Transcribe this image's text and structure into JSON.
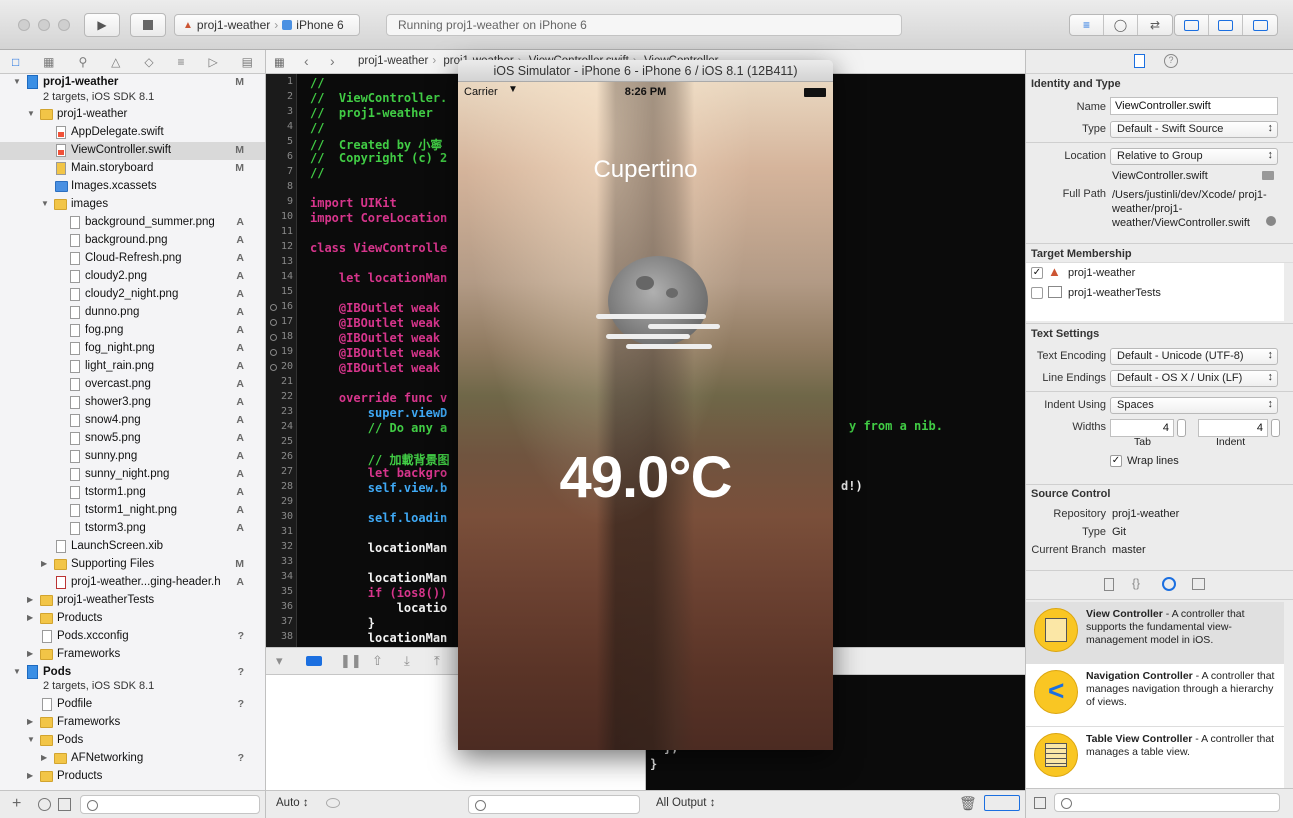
{
  "toolbar": {
    "scheme_project": "proj1-weather",
    "scheme_device": "iPhone 6",
    "status_text": "Running proj1-weather on iPhone 6"
  },
  "navigator": {
    "items": [
      {
        "label": "proj1-weather",
        "sub": "2 targets, iOS SDK 8.1",
        "badge": "M"
      },
      {
        "label": "proj1-weather",
        "badge": ""
      },
      {
        "label": "AppDelegate.swift",
        "badge": ""
      },
      {
        "label": "ViewController.swift",
        "badge": "M"
      },
      {
        "label": "Main.storyboard",
        "badge": "M"
      },
      {
        "label": "Images.xcassets",
        "badge": ""
      },
      {
        "label": "images",
        "badge": ""
      },
      {
        "label": "background_summer.png",
        "badge": "A"
      },
      {
        "label": "background.png",
        "badge": "A"
      },
      {
        "label": "Cloud-Refresh.png",
        "badge": "A"
      },
      {
        "label": "cloudy2.png",
        "badge": "A"
      },
      {
        "label": "cloudy2_night.png",
        "badge": "A"
      },
      {
        "label": "dunno.png",
        "badge": "A"
      },
      {
        "label": "fog.png",
        "badge": "A"
      },
      {
        "label": "fog_night.png",
        "badge": "A"
      },
      {
        "label": "light_rain.png",
        "badge": "A"
      },
      {
        "label": "overcast.png",
        "badge": "A"
      },
      {
        "label": "shower3.png",
        "badge": "A"
      },
      {
        "label": "snow4.png",
        "badge": "A"
      },
      {
        "label": "snow5.png",
        "badge": "A"
      },
      {
        "label": "sunny.png",
        "badge": "A"
      },
      {
        "label": "sunny_night.png",
        "badge": "A"
      },
      {
        "label": "tstorm1.png",
        "badge": "A"
      },
      {
        "label": "tstorm1_night.png",
        "badge": "A"
      },
      {
        "label": "tstorm3.png",
        "badge": "A"
      },
      {
        "label": "LaunchScreen.xib",
        "badge": ""
      },
      {
        "label": "Supporting Files",
        "badge": "M"
      },
      {
        "label": "proj1-weather...ging-header.h",
        "badge": "A"
      },
      {
        "label": "proj1-weatherTests",
        "badge": ""
      },
      {
        "label": "Products",
        "badge": ""
      },
      {
        "label": "Pods.xcconfig",
        "badge": "?"
      },
      {
        "label": "Frameworks",
        "badge": ""
      },
      {
        "label": "Pods",
        "sub": "2 targets, iOS SDK 8.1",
        "badge": "?"
      },
      {
        "label": "Podfile",
        "badge": "?"
      },
      {
        "label": "Frameworks",
        "badge": ""
      },
      {
        "label": "Pods",
        "badge": ""
      },
      {
        "label": "AFNetworking",
        "badge": "?"
      },
      {
        "label": "Products",
        "badge": ""
      }
    ]
  },
  "jumpbar": {
    "crumbs": [
      "proj1-weather",
      "proj1-weather",
      "ViewController.swift",
      "ViewController"
    ]
  },
  "editor": {
    "line_numbers": [
      "1",
      "2",
      "3",
      "4",
      "5",
      "6",
      "7",
      "8",
      "9",
      "10",
      "11",
      "12",
      "13",
      "14",
      "15",
      "16",
      "17",
      "18",
      "19",
      "20",
      "21",
      "22",
      "23",
      "24",
      "25",
      "26",
      "27",
      "28",
      "29",
      "30",
      "31",
      "32",
      "33",
      "34",
      "35",
      "36",
      "37",
      "38"
    ],
    "code": [
      "//",
      "//  ViewController.",
      "//  proj1-weather",
      "//",
      "//  Created by 小寧",
      "//  Copyright (c) 2",
      "//",
      "",
      "import UIKit",
      "import CoreLocation",
      "",
      "class ViewControlle",
      "",
      "    let locationMan",
      "",
      "    @IBOutlet weak",
      "    @IBOutlet weak",
      "    @IBOutlet weak",
      "    @IBOutlet weak",
      "    @IBOutlet weak",
      "",
      "    override func v",
      "        super.viewD",
      "        // Do any a",
      "",
      "        // 加載背景图",
      "        let backgro",
      "        self.view.b",
      "",
      "        self.loadin",
      "",
      "        locationMan",
      "",
      "        locationMan",
      "        if (ios8())",
      "            locatio",
      "        }",
      "        locationMan"
    ],
    "right_fragments": [
      "y from a nib.",
      "d!)"
    ]
  },
  "bottom": {
    "auto_label": "Auto ↕",
    "output_label": "All Output ↕"
  },
  "console": {
    "lines": [
      "},",
      "}"
    ]
  },
  "simulator": {
    "title": "iOS Simulator - iPhone 6 - iPhone 6 / iOS 8.1 (12B411)",
    "carrier": "Carrier",
    "time": "8:26 PM",
    "city": "Cupertino",
    "temperature": "49.0°C"
  },
  "inspector": {
    "identity_title": "Identity and Type",
    "name_label": "Name",
    "name_value": "ViewController.swift",
    "type_label": "Type",
    "type_value": "Default - Swift Source",
    "location_label": "Location",
    "location_value": "Relative to Group",
    "location_file": "ViewController.swift",
    "fullpath_label": "Full Path",
    "fullpath_value": "/Users/justinli/dev/Xcode/ proj1-weather/proj1- weather/ViewController.swift",
    "membership_title": "Target Membership",
    "target1": "proj1-weather",
    "target2": "proj1-weatherTests",
    "text_title": "Text Settings",
    "encoding_label": "Text Encoding",
    "encoding_value": "Default - Unicode (UTF-8)",
    "endings_label": "Line Endings",
    "endings_value": "Default - OS X / Unix (LF)",
    "indent_label": "Indent Using",
    "indent_value": "Spaces",
    "widths_label": "Widths",
    "tab_value": "4",
    "indent_width_value": "4",
    "tab_label": "Tab",
    "indent_sub_label": "Indent",
    "wrap_label": "Wrap lines",
    "source_title": "Source Control",
    "repo_label": "Repository",
    "repo_value": "proj1-weather",
    "sc_type_label": "Type",
    "sc_type_value": "Git",
    "branch_label": "Current Branch",
    "branch_value": "master",
    "library": [
      {
        "title": "View Controller",
        "desc": " - A controller that supports the fundamental view-management model in iOS."
      },
      {
        "title": "Navigation Controller",
        "desc": " - A controller that manages navigation through a hierarchy of views."
      },
      {
        "title": "Table View Controller",
        "desc": " - A controller that manages a table view."
      }
    ]
  }
}
